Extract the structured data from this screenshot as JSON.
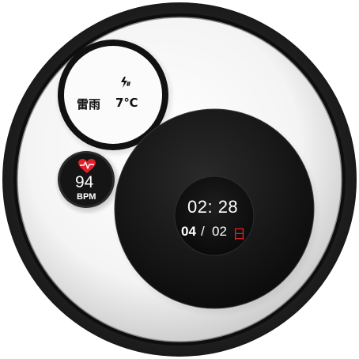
{
  "weather": {
    "icon": "thunderstorm-icon",
    "condition": "雷雨",
    "temperature": "7℃"
  },
  "heart_rate": {
    "icon": "heart-pulse-icon",
    "value": "94",
    "unit": "BPM",
    "icon_color": "#e0202a"
  },
  "clock": {
    "time": "02: 28",
    "date_month": "04",
    "date_separator": "/",
    "date_day": "02",
    "weekday": "日",
    "weekday_color": "#e0202a"
  }
}
